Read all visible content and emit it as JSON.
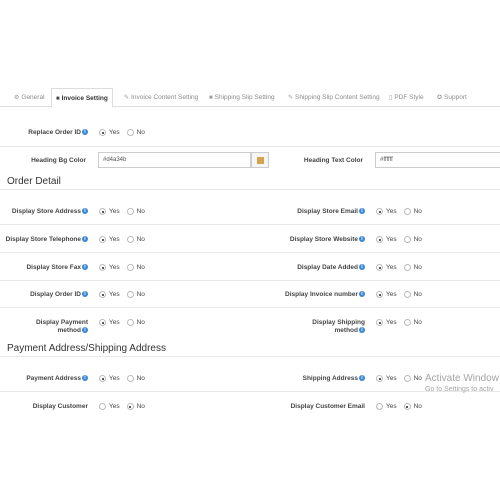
{
  "tabs": [
    {
      "label": "General",
      "icon": "gear-icon"
    },
    {
      "label": "Invoice Setting",
      "icon": "file-icon"
    },
    {
      "label": "Invoice Content Setting",
      "icon": "file-edit-icon"
    },
    {
      "label": "Shipping Slip Setting",
      "icon": "truck-icon"
    },
    {
      "label": "Shipping Slip Content Setting",
      "icon": "file-edit-icon"
    },
    {
      "label": "PDF Style",
      "icon": "pdf-icon"
    },
    {
      "label": "Support",
      "icon": "support-icon"
    }
  ],
  "active_tab": "Invoice Setting",
  "replace_order_id": {
    "label": "Replace Order ID",
    "yes": "Yes",
    "no": "No",
    "selected": "Yes"
  },
  "heading_bg_color": {
    "label": "Heading Bg Color",
    "value": "#d4a34b"
  },
  "heading_text_color": {
    "label": "Heading Text Color",
    "value": "#ffffff"
  },
  "swatch_color": "#d4a34b",
  "info_icon": "i",
  "order_detail": {
    "title": "Order Detail",
    "fields": [
      {
        "label": "Display Store Address",
        "selected": "Yes"
      },
      {
        "label": "Display Store Email",
        "selected": "Yes"
      },
      {
        "label": "Display Store Telephone",
        "selected": "Yes"
      },
      {
        "label": "Display Store Website",
        "selected": "Yes"
      },
      {
        "label": "Display Store Fax",
        "selected": "Yes"
      },
      {
        "label": "Display Date Added",
        "selected": "Yes"
      },
      {
        "label": "Display Order ID",
        "selected": "Yes"
      },
      {
        "label": "Display Invoice number",
        "selected": "Yes"
      },
      {
        "label_line1": "Display Payment",
        "label_line2": "method",
        "selected": "Yes"
      },
      {
        "label_line1": "Display Shipping",
        "label_line2": "method",
        "selected": "Yes"
      }
    ]
  },
  "payment_shipping": {
    "title": "Payment Address/Shipping Address",
    "fields": [
      {
        "label": "Payment Address",
        "selected": "Yes"
      },
      {
        "label": "Shipping Address",
        "selected": "Yes"
      },
      {
        "label": "Display Customer",
        "selected": "No"
      },
      {
        "label": "Display Customer Email",
        "selected": "No"
      }
    ]
  },
  "radio_yes": "Yes",
  "radio_no": "No",
  "watermark": {
    "title": "Activate Window",
    "subtitle": "Go to Settings to activ"
  }
}
